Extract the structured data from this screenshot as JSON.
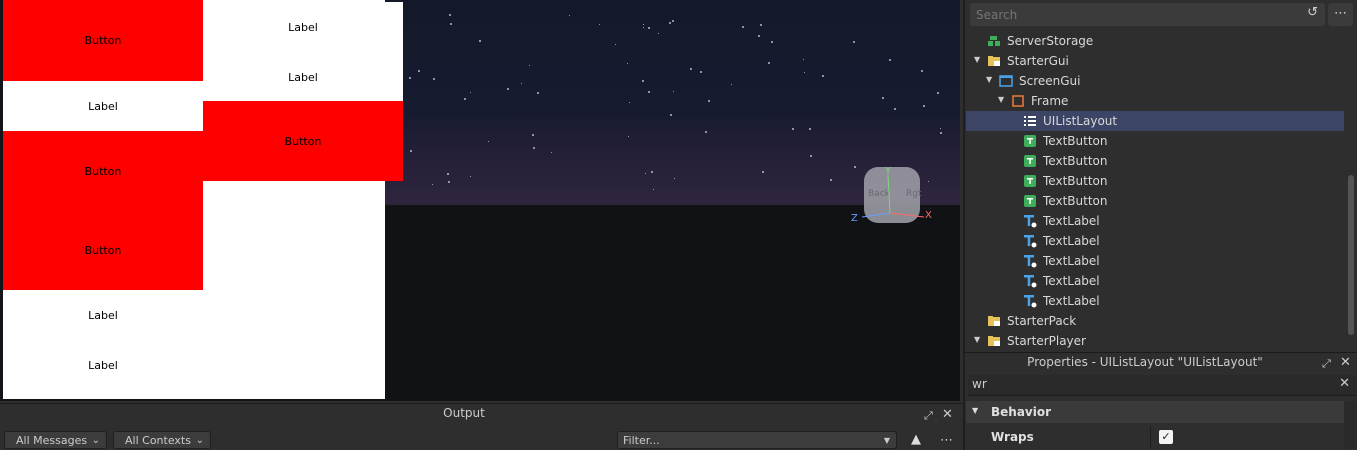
{
  "viewport": {
    "gui": {
      "col1": [
        "Button",
        "Label",
        "Button",
        "Button",
        "Label",
        "Label"
      ],
      "col2": [
        "Label",
        "Label",
        "Button"
      ]
    },
    "view_cube": {
      "face_back": "Back",
      "face_right": "Rgt",
      "axis_y": "Y",
      "axis_x": "X",
      "axis_z": "Z"
    }
  },
  "output": {
    "title": "Output",
    "messages_filter": "All Messages",
    "contexts_filter": "All Contexts",
    "filter_placeholder": "Filter..."
  },
  "explorer": {
    "search_placeholder": "Search",
    "tree": [
      {
        "label": "ServerStorage",
        "icon": "server-storage-icon"
      },
      {
        "label": "StarterGui",
        "icon": "folder-icon"
      },
      {
        "label": "ScreenGui",
        "icon": "screen-gui-icon"
      },
      {
        "label": "Frame",
        "icon": "frame-icon"
      },
      {
        "label": "UIListLayout",
        "icon": "list-layout-icon"
      },
      {
        "label": "TextButton",
        "icon": "text-button-icon"
      },
      {
        "label": "TextButton",
        "icon": "text-button-icon"
      },
      {
        "label": "TextButton",
        "icon": "text-button-icon"
      },
      {
        "label": "TextButton",
        "icon": "text-button-icon"
      },
      {
        "label": "TextLabel",
        "icon": "text-label-icon"
      },
      {
        "label": "TextLabel",
        "icon": "text-label-icon"
      },
      {
        "label": "TextLabel",
        "icon": "text-label-icon"
      },
      {
        "label": "TextLabel",
        "icon": "text-label-icon"
      },
      {
        "label": "TextLabel",
        "icon": "text-label-icon"
      },
      {
        "label": "StarterPack",
        "icon": "folder-icon"
      },
      {
        "label": "StarterPlayer",
        "icon": "folder-icon"
      }
    ]
  },
  "properties": {
    "title": "Properties - UIListLayout \"UIListLayout\"",
    "filter_value": "wr",
    "section": "Behavior",
    "prop_name": "Wraps",
    "prop_checked": "✓"
  },
  "colors": {
    "selected_row": "#3c4565",
    "gui_button": "#ff0000",
    "gui_label": "#ffffff"
  }
}
